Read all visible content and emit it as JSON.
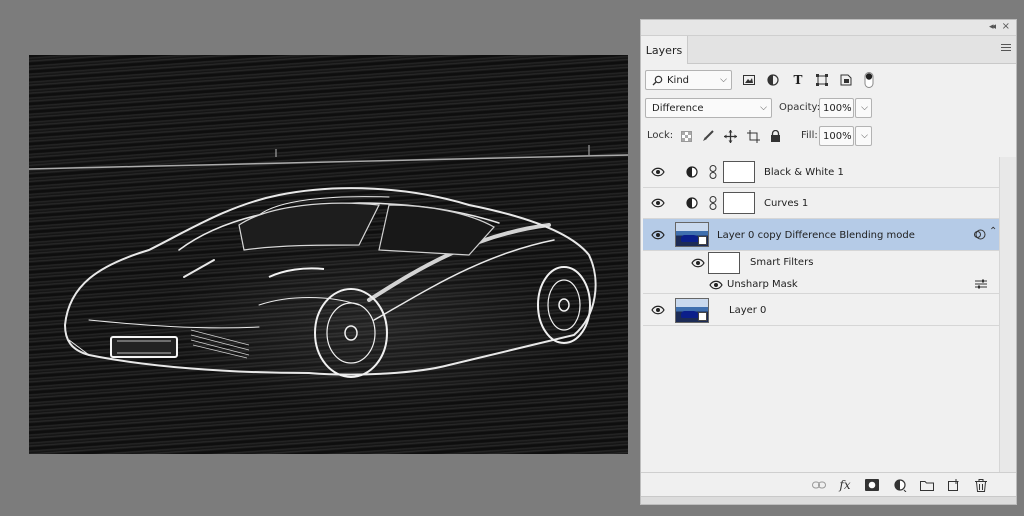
{
  "panel": {
    "collapse_glyph": "◂◂",
    "close_glyph": "×",
    "tab_label": "Layers"
  },
  "filter": {
    "kind_label": "Kind",
    "kind_icon": "search-icon",
    "icons": [
      "image-filter-icon",
      "adjustment-filter-icon",
      "type-filter-icon",
      "shape-filter-icon",
      "smart-object-filter-icon",
      "filter-toggle-icon"
    ]
  },
  "blend": {
    "mode": "Difference",
    "opacity_label": "Opacity:",
    "opacity_value": "100%"
  },
  "lock": {
    "label": "Lock:",
    "icons": [
      "lock-transparent-icon",
      "lock-paint-icon",
      "lock-position-icon",
      "lock-artboard-icon",
      "lock-all-icon"
    ],
    "fill_label": "Fill:",
    "fill_value": "100%"
  },
  "layers": [
    {
      "name": "Black & White 1",
      "type": "adjustment",
      "visible": true
    },
    {
      "name": "Curves 1",
      "type": "adjustment",
      "visible": true
    },
    {
      "name": "Layer 0 copy Difference Blending mode",
      "type": "smart-object",
      "visible": true,
      "selected": true
    },
    {
      "name": "Smart Filters",
      "type": "smart-filters",
      "visible": true
    },
    {
      "name": "Unsharp Mask",
      "type": "filter",
      "visible": true
    },
    {
      "name": "Layer 0",
      "type": "smart-object",
      "visible": true
    }
  ],
  "footer_icons": [
    "link-layers-icon",
    "fx-icon",
    "add-mask-icon",
    "new-adjustment-icon",
    "new-group-icon",
    "new-layer-icon",
    "delete-layer-icon"
  ],
  "footer_fx_label": "fx",
  "colors": {
    "selected_row": "#b5cbe7",
    "panel_bg": "#f0f0f0",
    "workspace_bg": "#7c7c7c"
  }
}
